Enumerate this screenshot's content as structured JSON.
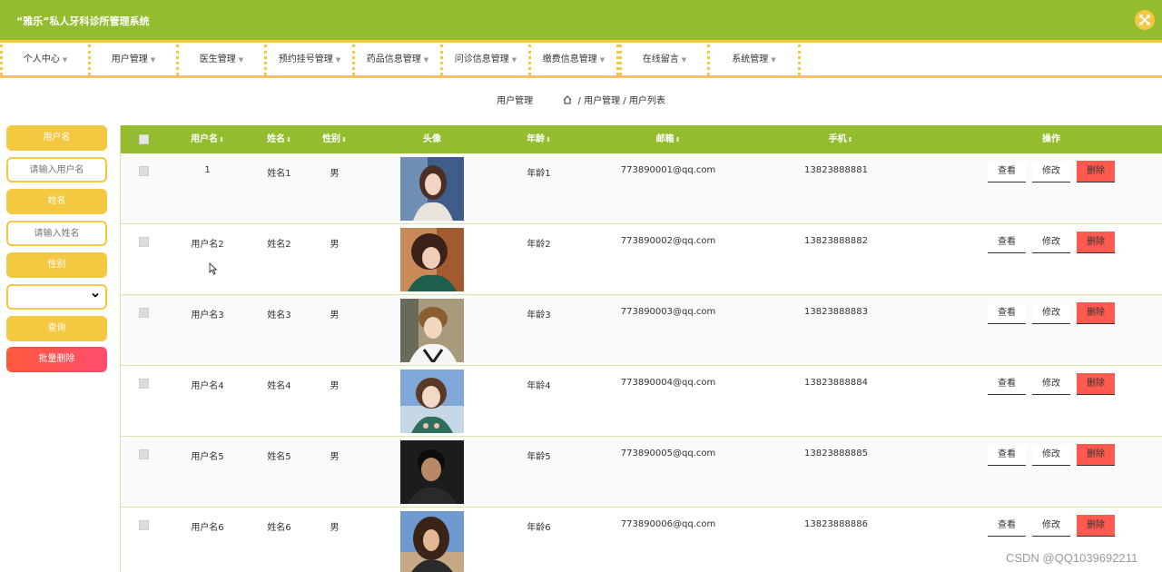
{
  "app": {
    "title": "“雅乐”私人牙科诊所管理系统",
    "close_icon": "close-expand-icon"
  },
  "nav": {
    "items": [
      {
        "label": "个人中心"
      },
      {
        "label": "用户管理"
      },
      {
        "label": "医生管理"
      },
      {
        "label": "预约挂号管理"
      },
      {
        "label": "药品信息管理"
      },
      {
        "label": "问诊信息管理"
      },
      {
        "label": "缴费信息管理"
      },
      {
        "label": "在线留言"
      },
      {
        "label": "系统管理"
      }
    ]
  },
  "breadcrumb": {
    "module": "用户管理",
    "path": "/ 用户管理 / 用户列表"
  },
  "search": {
    "username_label": "用户名",
    "username_placeholder": "请输入用户名",
    "name_label": "姓名",
    "name_placeholder": "请输入姓名",
    "gender_label": "性别",
    "gender_value": "",
    "query_button": "查询",
    "batch_delete_button": "批量删除"
  },
  "table": {
    "headers": {
      "username": "用户名",
      "name": "姓名",
      "gender": "性别",
      "avatar": "头像",
      "age": "年龄",
      "email": "邮箱",
      "phone": "手机",
      "actions": "操作"
    },
    "action_labels": {
      "view": "查看",
      "edit": "修改",
      "delete": "删除"
    },
    "rows": [
      {
        "username": "1",
        "name": "姓名1",
        "gender": "男",
        "age": "年龄1",
        "email": "773890001@qq.com",
        "phone": "13823888881"
      },
      {
        "username": "用户名2",
        "name": "姓名2",
        "gender": "男",
        "age": "年龄2",
        "email": "773890002@qq.com",
        "phone": "13823888882"
      },
      {
        "username": "用户名3",
        "name": "姓名3",
        "gender": "男",
        "age": "年龄3",
        "email": "773890003@qq.com",
        "phone": "13823888883"
      },
      {
        "username": "用户名4",
        "name": "姓名4",
        "gender": "男",
        "age": "年龄4",
        "email": "773890004@qq.com",
        "phone": "13823888884"
      },
      {
        "username": "用户名5",
        "name": "姓名5",
        "gender": "男",
        "age": "年龄5",
        "email": "773890005@qq.com",
        "phone": "13823888885"
      },
      {
        "username": "用户名6",
        "name": "姓名6",
        "gender": "男",
        "age": "年龄6",
        "email": "773890006@qq.com",
        "phone": "13823888886"
      }
    ]
  },
  "watermark": "CSDN @QQ1039692211",
  "colors": {
    "primary_green": "#93bd2e",
    "accent_yellow": "#f5c842",
    "delete_red": "#ff5a4f"
  }
}
